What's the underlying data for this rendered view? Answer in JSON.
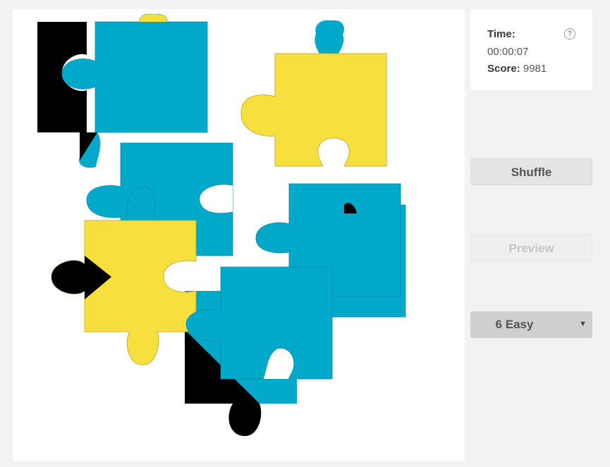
{
  "status": {
    "time_label": "Time:",
    "time_value": "00:00:07",
    "score_label": "Score:",
    "score_value": "9981",
    "help_icon": "?"
  },
  "controls": {
    "shuffle_label": "Shuffle",
    "preview_label": "Preview",
    "difficulty_value": "6 Easy"
  },
  "colors": {
    "blue": "#00a9c9",
    "yellow": "#f7df3e",
    "black": "#000000"
  }
}
